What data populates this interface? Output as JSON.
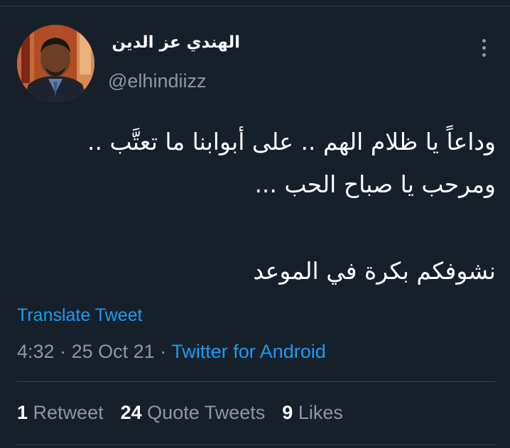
{
  "author": {
    "display_name": "الهندي عز الدين",
    "handle": "@elhindiizz"
  },
  "tweet": {
    "lines": [
      "وداعاً يا ظلام الهم .. على أبوابنا ما تعتَّب ..",
      "ومرحب يا صباح الحب ...",
      "نشوفكم بكرة في الموعد"
    ]
  },
  "translate_label": "Translate Tweet",
  "meta": {
    "time": "4:32",
    "separator": "·",
    "date": "25 Oct 21",
    "source": "Twitter for Android"
  },
  "stats": {
    "retweets_count": "1",
    "retweets_label": "Retweet",
    "quotes_count": "24",
    "quotes_label": "Quote Tweets",
    "likes_count": "9",
    "likes_label": "Likes"
  },
  "icons": {
    "more": "more-vertical-icon",
    "avatar": "profile-photo"
  },
  "colors": {
    "background": "#15202b",
    "text_primary": "#ffffff",
    "text_secondary": "#8b98a5",
    "link": "#1d9bf0",
    "divider": "#38444d"
  }
}
